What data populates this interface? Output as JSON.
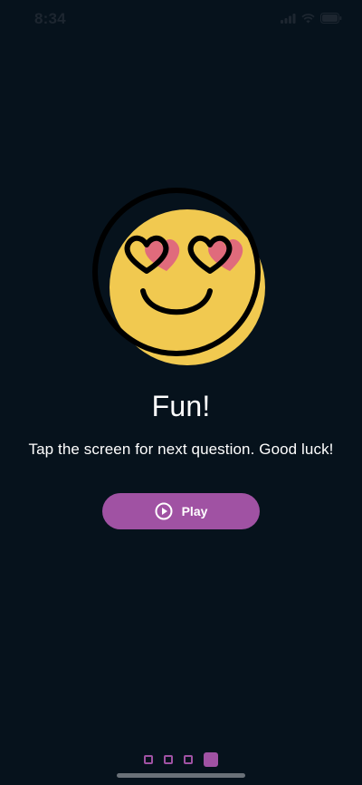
{
  "status_bar": {
    "time": "8:34",
    "icons": [
      "signal-icon",
      "wifi-icon",
      "battery-icon"
    ]
  },
  "illustration": {
    "icon": "heart-eyes-smiley-icon",
    "colors": {
      "face": "#f1c950",
      "outline": "#000000",
      "hearts": "#e06b7c"
    }
  },
  "content": {
    "title": "Fun!",
    "subtitle": "Tap the screen for next question. Good luck!"
  },
  "play_button": {
    "label": "Play",
    "icon": "play-circle-icon",
    "color": "#a052a3"
  },
  "pager": {
    "count": 4,
    "active_index": 3
  },
  "colors": {
    "background": "#06121c",
    "accent": "#a052a3"
  }
}
